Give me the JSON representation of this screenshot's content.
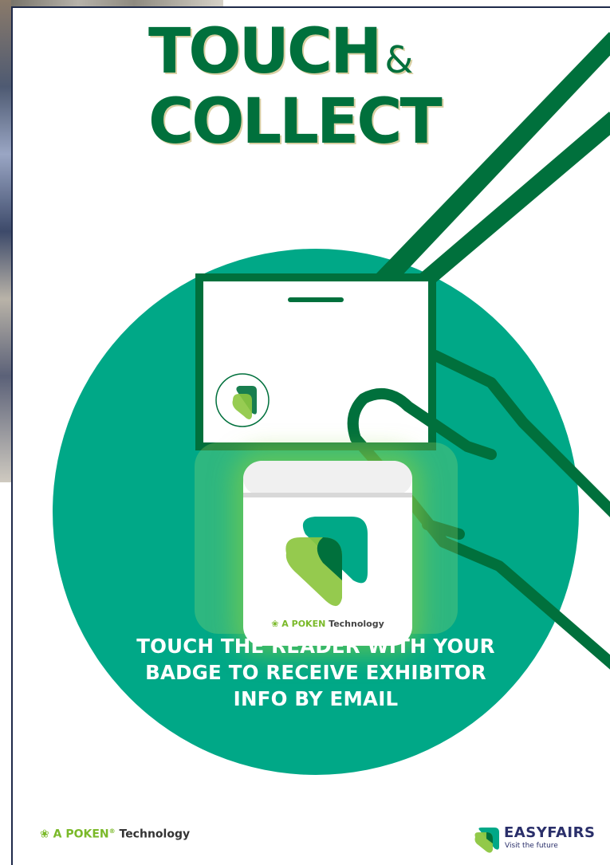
{
  "poster": {
    "title_line1": "TOUCH",
    "title_amp": "&",
    "title_line2": "COLLECT",
    "headline_line1": "TOUCH THE READER WITH YOUR",
    "headline_line2": "BADGE TO RECEIVE EXHIBITOR",
    "headline_line3": "INFO BY EMAIL",
    "reader_brand_prefix": "A",
    "reader_brand_name": "POKEN",
    "reader_brand_suffix": "Technology"
  },
  "footer": {
    "poken_prefix": "A",
    "poken_name": "POKEN",
    "poken_tm": "®",
    "poken_suffix": "Technology",
    "easyfairs_name": "EASYFAIRS",
    "easyfairs_tagline": "Visit the future"
  },
  "colors": {
    "primary_green": "#00703c",
    "circle_green": "#00a887",
    "light_green": "#8cc63f",
    "navy": "#2a2f6a"
  },
  "icons": {
    "poken_logo": "poken-leaf-icon",
    "easyfairs_logo": "easyfairs-shape-icon",
    "reader_logo": "poken-heart-shape-icon"
  }
}
